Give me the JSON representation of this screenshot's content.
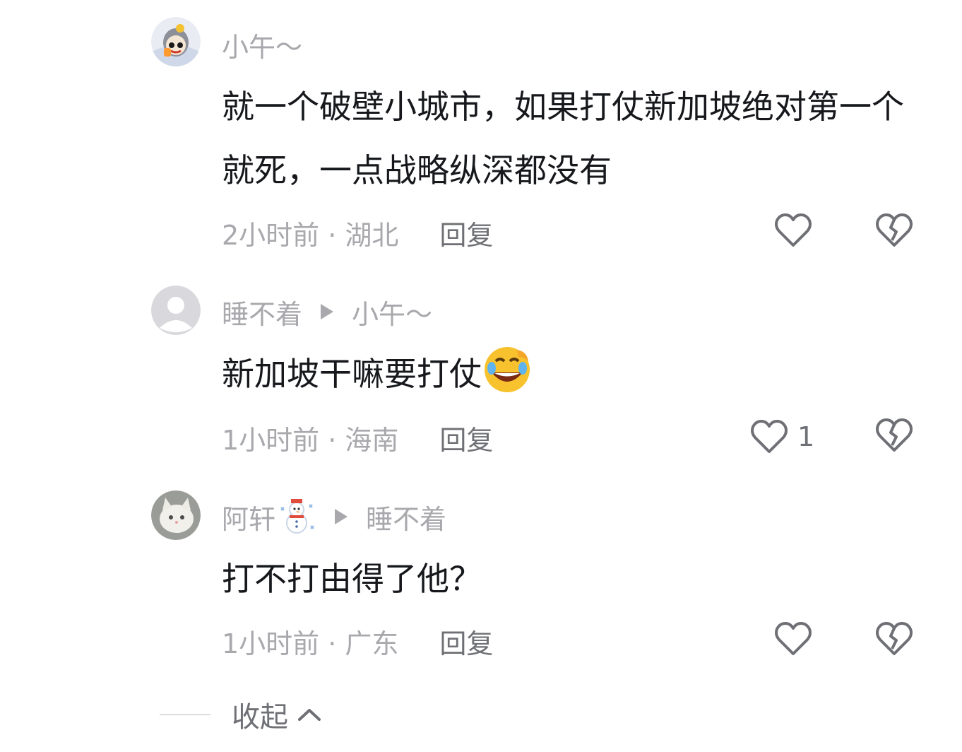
{
  "comments": [
    {
      "author": "小午～",
      "text": "就一个破壁小城市，如果打仗新加坡绝对第一个就死，一点战略纵深都没有",
      "time_location": "2小时前 · 湖北",
      "reply_label": "回复",
      "like_count": ""
    },
    {
      "author": "睡不着",
      "reply_to": "小午～",
      "text": "新加坡干嘛要打仗",
      "emoji": "rofl-emoji",
      "time_location": "1小时前 · 海南",
      "reply_label": "回复",
      "like_count": "1"
    },
    {
      "author": "阿轩",
      "author_emoji": "snowman-emoji",
      "reply_to": "睡不着",
      "text": "打不打由得了他？",
      "time_location": "1小时前 · 广东",
      "reply_label": "回复",
      "like_count": ""
    }
  ],
  "collapse_label": "收起",
  "colors": {
    "text": "#16181c",
    "meta": "#a8a8ad",
    "reply": "#6f7075",
    "icon": "#6f7075"
  }
}
